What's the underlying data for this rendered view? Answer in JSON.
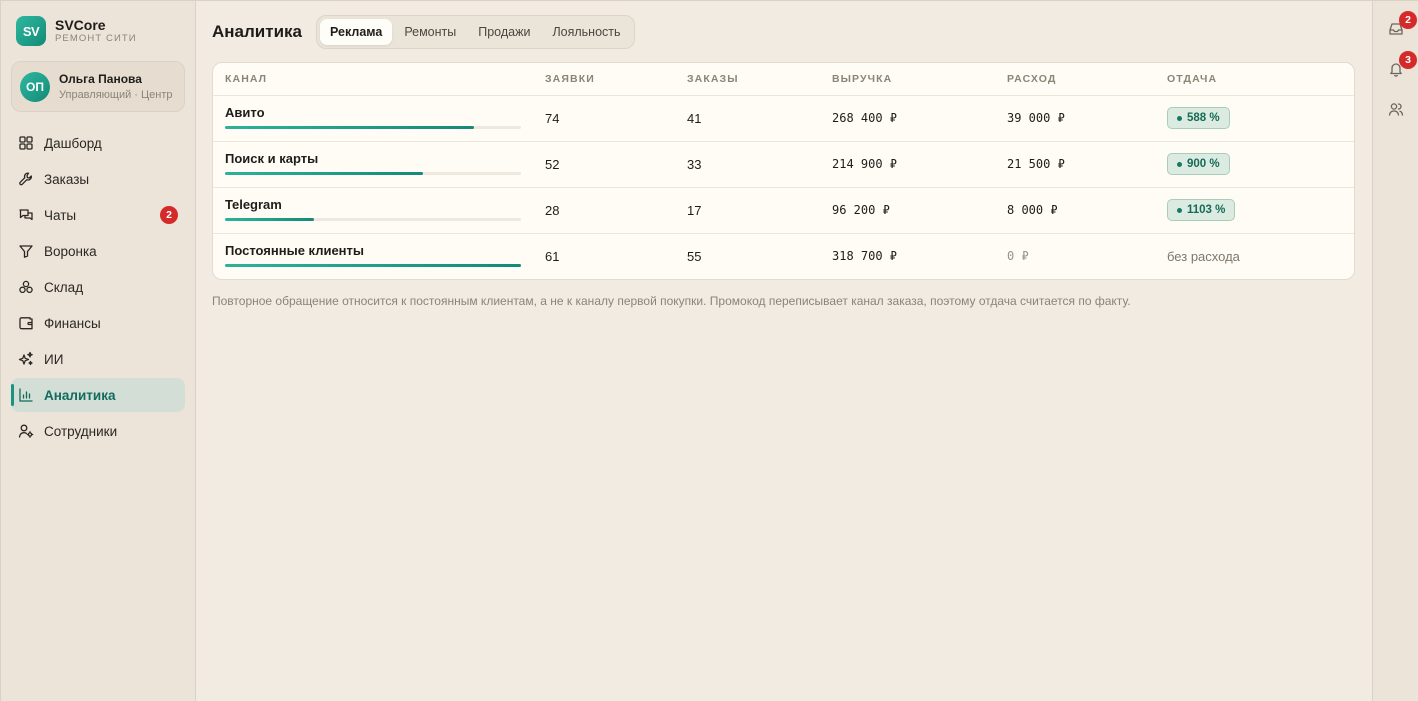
{
  "brand": {
    "logo": "SV",
    "name": "SVCore",
    "subtitle": "РЕМОНТ СИТИ"
  },
  "user": {
    "initials": "ОП",
    "name": "Ольга Панова",
    "role": "Управляющий · Центр"
  },
  "sidebar": {
    "items": [
      {
        "label": "Дашборд",
        "icon": "grid-icon"
      },
      {
        "label": "Заказы",
        "icon": "wrench-icon"
      },
      {
        "label": "Чаты",
        "icon": "chat-icon",
        "badge": "2"
      },
      {
        "label": "Воронка",
        "icon": "funnel-icon"
      },
      {
        "label": "Склад",
        "icon": "boxes-icon"
      },
      {
        "label": "Финансы",
        "icon": "wallet-icon"
      },
      {
        "label": "ИИ",
        "icon": "sparkles-icon"
      },
      {
        "label": "Аналитика",
        "icon": "bar-chart-icon",
        "active": true
      },
      {
        "label": "Сотрудники",
        "icon": "user-settings-icon"
      }
    ]
  },
  "header": {
    "title": "Аналитика",
    "tabs": [
      {
        "label": "Реклама",
        "active": true
      },
      {
        "label": "Ремонты"
      },
      {
        "label": "Продажи"
      },
      {
        "label": "Лояльность"
      }
    ]
  },
  "table": {
    "columns": [
      "КАНАЛ",
      "ЗАЯВКИ",
      "ЗАКАЗЫ",
      "ВЫРУЧКА",
      "РАСХОД",
      "ОТДАЧА"
    ],
    "rows": [
      {
        "channel": "Авито",
        "share": 0.84,
        "leads": "74",
        "orders": "41",
        "revenue": "268 400 ₽",
        "spend": "39 000 ₽",
        "roi": "588 %"
      },
      {
        "channel": "Поиск и карты",
        "share": 0.67,
        "leads": "52",
        "orders": "33",
        "revenue": "214 900 ₽",
        "spend": "21 500 ₽",
        "roi": "900 %"
      },
      {
        "channel": "Telegram",
        "share": 0.3,
        "leads": "28",
        "orders": "17",
        "revenue": "96 200 ₽",
        "spend": "8 000 ₽",
        "roi": "1103 %"
      },
      {
        "channel": "Постоянные клиенты",
        "share": 1.0,
        "leads": "61",
        "orders": "55",
        "revenue": "318 700 ₽",
        "spend": "0 ₽",
        "roi": "без расхода"
      }
    ]
  },
  "note": "Повторное обращение относится к постоянным клиентам, а не к каналу первой покупки. Промокод переписывает канал заказа, поэтому отдача считается по факту.",
  "rail": {
    "inbox_badge": "2",
    "notifications_badge": "3"
  },
  "colors": {
    "accent": "#17967f",
    "badge": "#d42a2a",
    "background": "#f1ebe2"
  }
}
